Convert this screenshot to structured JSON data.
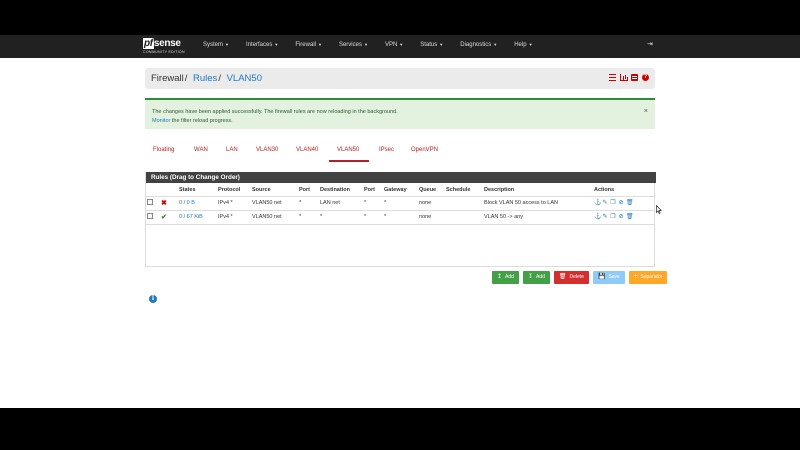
{
  "brand": {
    "logo_prefix": "pf",
    "logo_name": "sense",
    "edition": "COMMUNITY EDITION"
  },
  "nav": [
    {
      "label": "System"
    },
    {
      "label": "Interfaces"
    },
    {
      "label": "Firewall"
    },
    {
      "label": "Services"
    },
    {
      "label": "VPN"
    },
    {
      "label": "Status"
    },
    {
      "label": "Diagnostics"
    },
    {
      "label": "Help"
    }
  ],
  "breadcrumb": {
    "first": "Firewall",
    "second": "Rules",
    "third": "VLAN50",
    "sep": "/"
  },
  "alert": {
    "line1": "The changes have been applied successfully. The firewall rules are now reloading in the background.",
    "monitor_link": "Monitor",
    "line2_rest": " the filter reload progress.",
    "close": "×"
  },
  "tabs": [
    {
      "label": "Floating"
    },
    {
      "label": "WAN"
    },
    {
      "label": "LAN"
    },
    {
      "label": "VLAN30"
    },
    {
      "label": "VLAN40"
    },
    {
      "label": "VLAN50"
    },
    {
      "label": "IPsec"
    },
    {
      "label": "OpenVPN"
    }
  ],
  "table": {
    "title": "Rules (Drag to Change Order)",
    "headers": [
      "",
      "",
      "States",
      "Protocol",
      "Source",
      "Port",
      "Destination",
      "Port",
      "Gateway",
      "Queue",
      "Schedule",
      "Description",
      "Actions"
    ],
    "rows": [
      {
        "states": "0 / 0 B",
        "protocol": "IPv4 *",
        "source": "VLAN50 net",
        "src_port": "*",
        "destination": "LAN net",
        "dst_port": "*",
        "gateway": "*",
        "queue": "none",
        "schedule": "",
        "description": "Block VLAN 50 access to LAN"
      },
      {
        "states": "0 / 67 KiB",
        "protocol": "IPv4 *",
        "source": "VLAN50 net",
        "src_port": "*",
        "destination": "*",
        "dst_port": "*",
        "gateway": "*",
        "queue": "none",
        "schedule": "",
        "description": "VLAN 50 -> any"
      }
    ]
  },
  "buttons": {
    "add_top": "Add",
    "add_bottom": "Add",
    "delete": "Delete",
    "save": "Save",
    "separator": "Separator"
  },
  "colors": {
    "nav_bg": "#212121",
    "accent_red": "#b22222",
    "link_blue": "#217ac0",
    "success_green": "#43a047"
  }
}
